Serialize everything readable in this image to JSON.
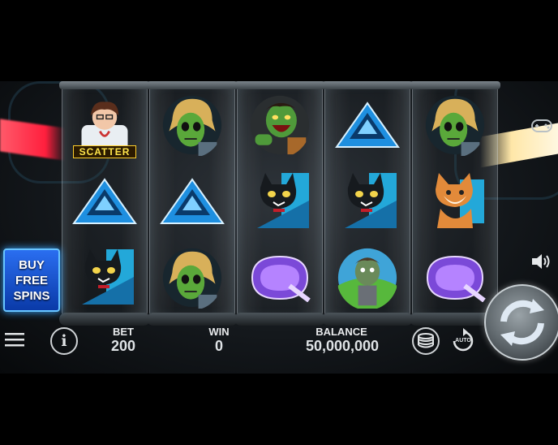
{
  "game": {
    "buy_button": {
      "line1": "BUY",
      "line2": "FREE",
      "line3": "SPINS"
    },
    "scatter_label": "SCATTER",
    "bottom": {
      "bet_label": "BET",
      "bet_value": "200",
      "win_label": "WIN",
      "win_value": "0",
      "balance_label": "BALANCE",
      "balance_value": "50,000,000",
      "auto_label": "AUTO"
    },
    "reels": [
      [
        "scientist-scatter",
        "A",
        "cat"
      ],
      [
        "zombie-blonde",
        "A",
        "zombie-blonde"
      ],
      [
        "zombie-roar",
        "cat",
        "Q"
      ],
      [
        "A",
        "cat",
        "zombie-boy"
      ],
      [
        "zombie-blonde",
        "fox",
        "Q"
      ]
    ],
    "colors": {
      "accent_blue": "#2a6ef0",
      "lamp_red": "#ff1f3d",
      "scatter_yellow": "#ffe54a"
    }
  }
}
